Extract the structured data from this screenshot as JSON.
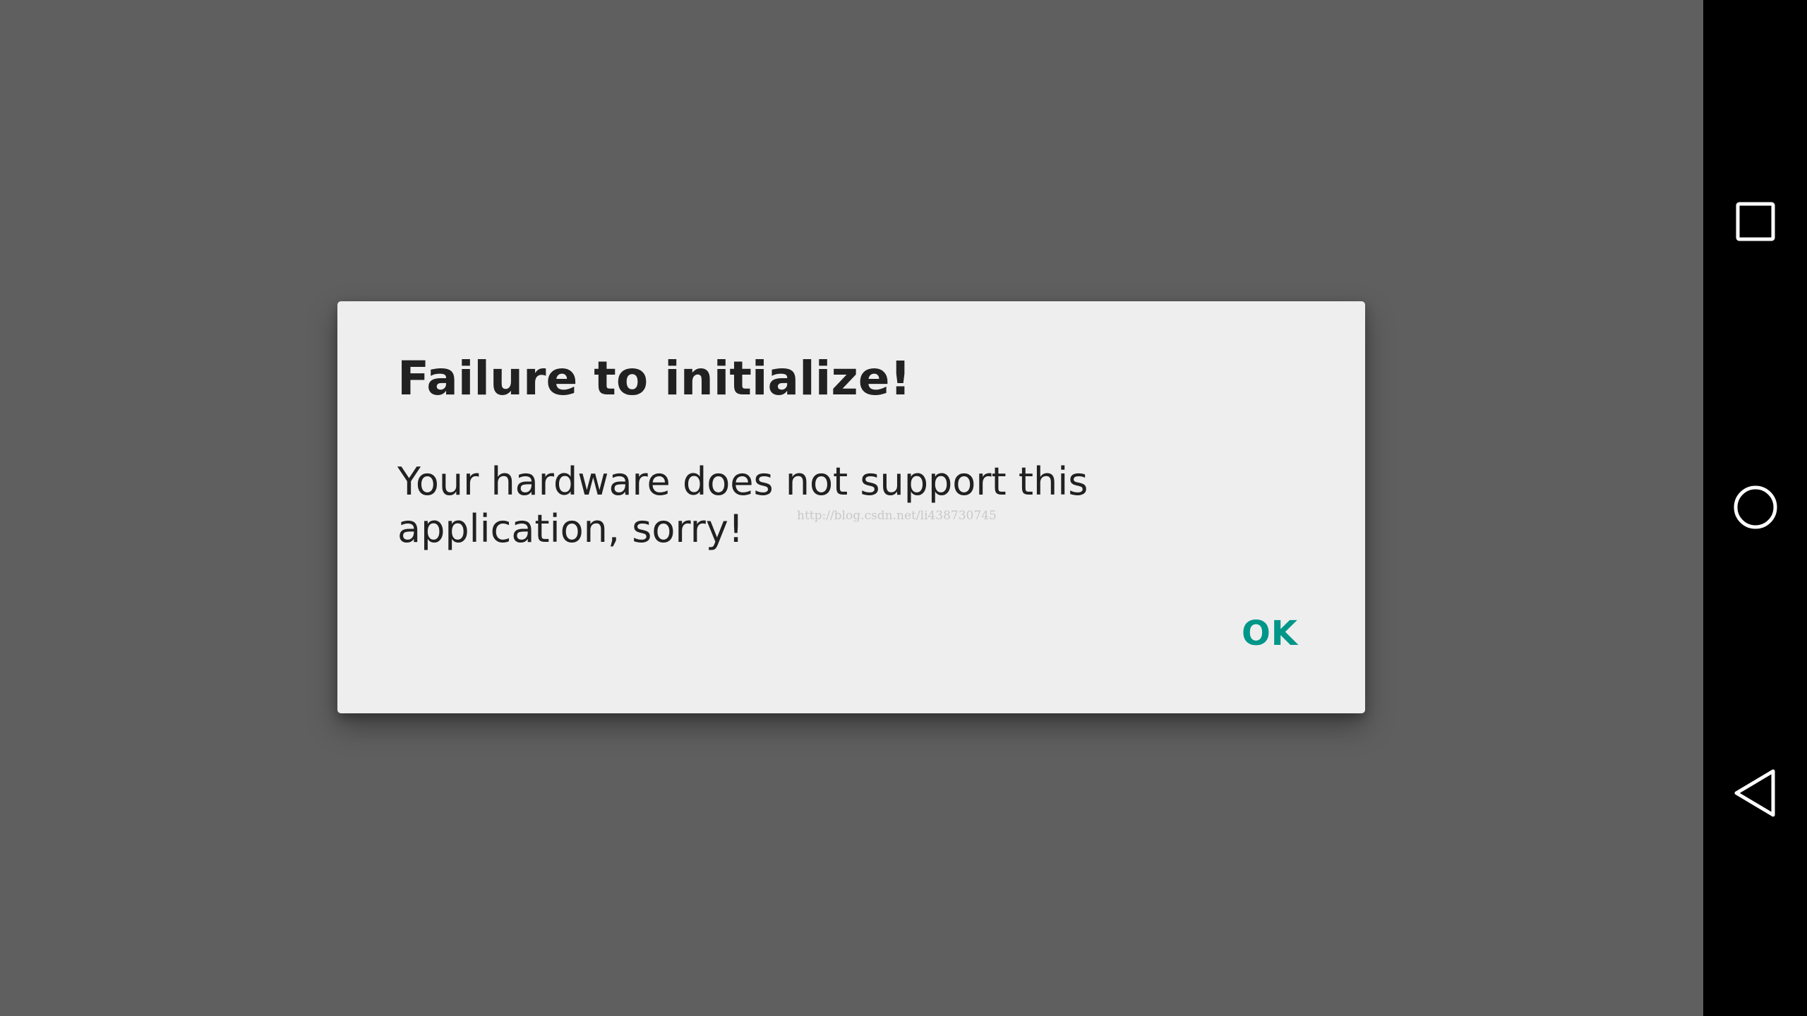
{
  "dialog": {
    "title": "Failure to initialize!",
    "message": "Your hardware does not support this application, sorry!",
    "ok_label": "OK",
    "watermark": "http://blog.csdn.net/li438730745"
  },
  "navbar": {
    "recents_icon": "recents-square-icon",
    "home_icon": "home-circle-icon",
    "back_icon": "back-triangle-icon"
  },
  "colors": {
    "scrim": "#5f5f5f",
    "dialog_background": "#eeeeee",
    "text_primary": "#212121",
    "accent": "#009688",
    "navbar": "#000000"
  }
}
